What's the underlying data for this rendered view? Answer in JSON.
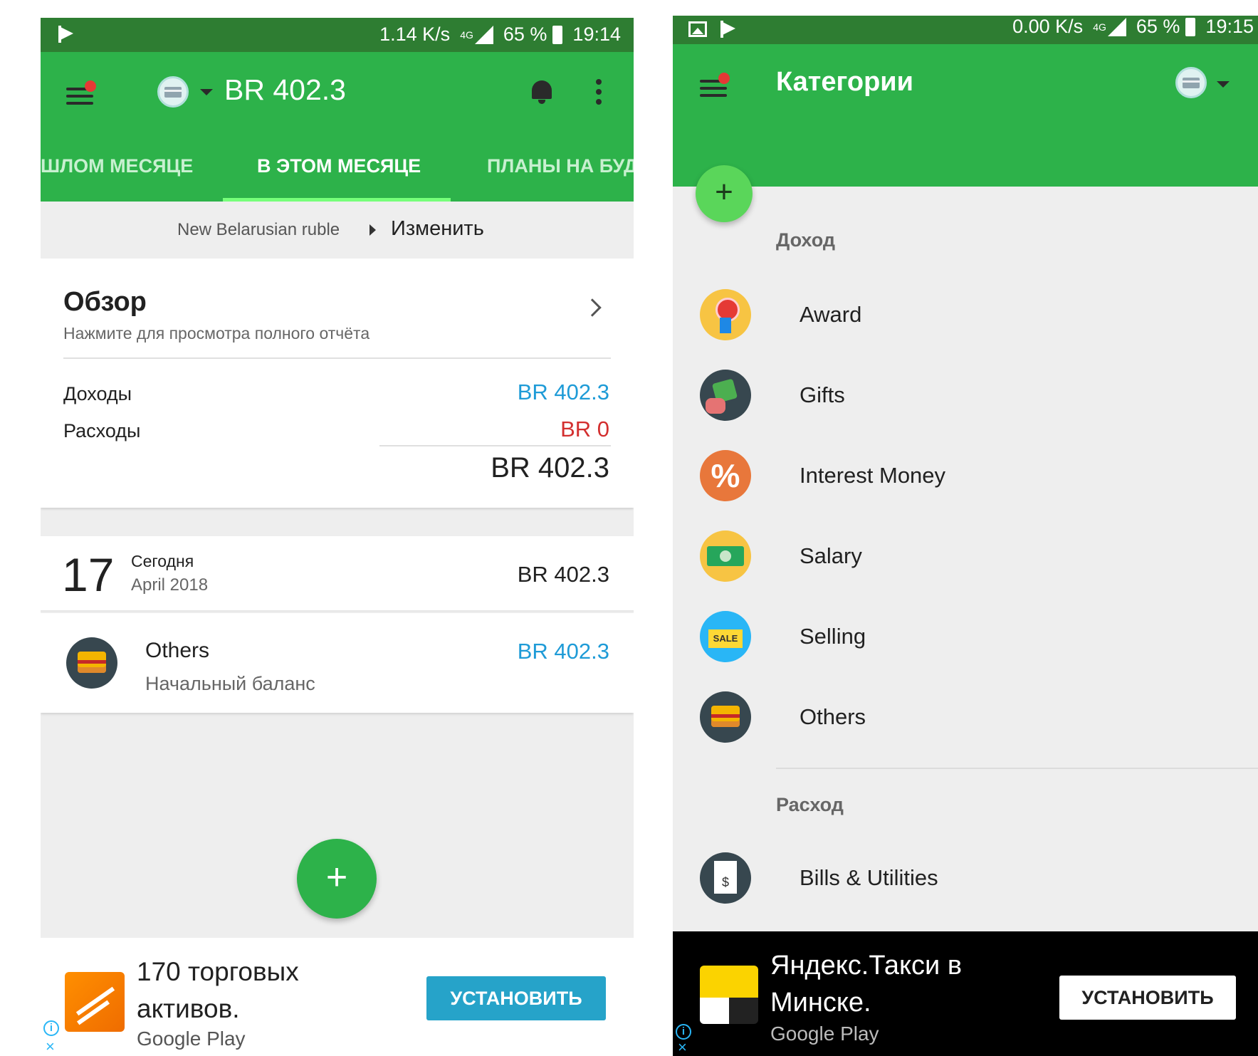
{
  "left_screen": {
    "status_bar": {
      "speed": "1.14 K/s",
      "network": "4G",
      "battery": "65 %",
      "time": "19:14"
    },
    "header": {
      "balance": "BR 402.3"
    },
    "tabs": [
      {
        "label": "ШЛОМ МЕСЯЦЕ"
      },
      {
        "label": "В ЭТОМ МЕСЯЦЕ"
      },
      {
        "label": "ПЛАНЫ НА БУД"
      }
    ],
    "currency": {
      "name": "New Belarusian ruble",
      "change_label": "Изменить"
    },
    "overview": {
      "title": "Обзор",
      "subtitle": "Нажмите для просмотра полного отчёта",
      "income_label": "Доходы",
      "income_value": "BR 402.3",
      "expense_label": "Расходы",
      "expense_value": "BR 0",
      "total": "BR 402.3"
    },
    "day_group": {
      "day": "17",
      "label": "Сегодня",
      "month": "April 2018",
      "total": "BR 402.3"
    },
    "transaction": {
      "category": "Others",
      "note": "Начальный баланс",
      "amount": "BR 402.3"
    },
    "fab_label": "+",
    "ad": {
      "text_line1": "170 торговых",
      "text_line2": "активов.",
      "store": "Google Play",
      "button": "УСТАНОВИТЬ"
    }
  },
  "right_screen": {
    "status_bar": {
      "speed": "0.00 K/s",
      "network": "4G",
      "battery": "65 %",
      "time": "19:15"
    },
    "header": {
      "title": "Категории"
    },
    "fab_label": "+",
    "income_section": {
      "label": "Доход",
      "items": [
        {
          "name": "Award",
          "icon": "award-icon"
        },
        {
          "name": "Gifts",
          "icon": "gifts-icon"
        },
        {
          "name": "Interest Money",
          "icon": "interest-icon"
        },
        {
          "name": "Salary",
          "icon": "salary-icon"
        },
        {
          "name": "Selling",
          "icon": "selling-icon"
        },
        {
          "name": "Others",
          "icon": "box-icon"
        }
      ]
    },
    "expense_section": {
      "label": "Расход",
      "items": [
        {
          "name": "Bills & Utilities",
          "icon": "bills-icon"
        }
      ]
    },
    "interest_glyph": "%",
    "ad": {
      "text_line1": "Яндекс.Такси в",
      "text_line2": "Минске.",
      "store": "Google Play",
      "button": "УСТАНОВИТЬ"
    }
  },
  "ad_choice_glyph": "i",
  "ad_close_glyph": "×"
}
